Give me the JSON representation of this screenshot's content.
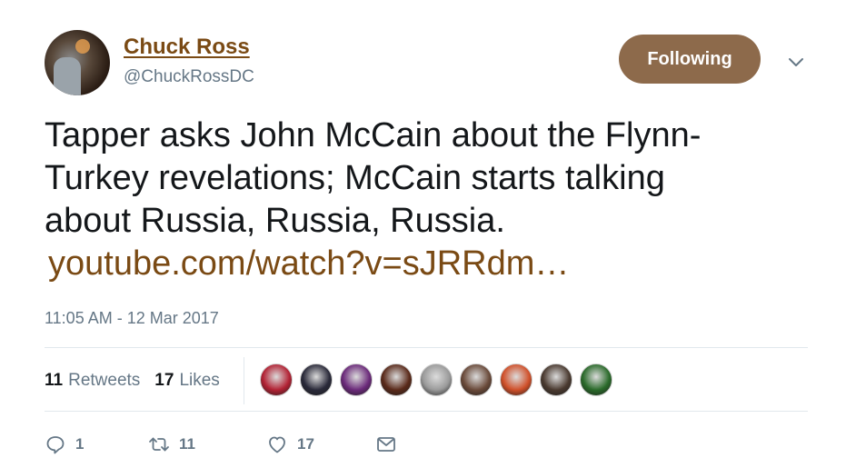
{
  "author": {
    "name": "Chuck Ross",
    "handle": "@ChuckRossDC"
  },
  "follow_button": {
    "label": "Following",
    "color": "#8d6a4b"
  },
  "tweet": {
    "line1": "Tapper asks John McCain about the Flynn-",
    "line2": "Turkey revelations; McCain starts talking",
    "line3": "about Russia, Russia, Russia.",
    "link": "youtube.com/watch?v=sJRRdm…",
    "link_color": "#7a4a14"
  },
  "timestamp": "11:05 AM - 12 Mar 2017",
  "stats": {
    "retweets_count": "11",
    "retweets_label": "Retweets",
    "likes_count": "17",
    "likes_label": "Likes"
  },
  "likers": [
    {
      "name": "liker-avatar-flag",
      "color": "#b22234"
    },
    {
      "name": "liker-avatar-2",
      "color": "#2a2a3a"
    },
    {
      "name": "liker-avatar-3",
      "color": "#6b2a7a"
    },
    {
      "name": "liker-avatar-4",
      "color": "#5a2a1a"
    },
    {
      "name": "liker-avatar-5",
      "color": "#9a9a9a"
    },
    {
      "name": "liker-avatar-6",
      "color": "#6a4a3a"
    },
    {
      "name": "liker-avatar-7",
      "color": "#d0502a"
    },
    {
      "name": "liker-avatar-8",
      "color": "#4a3a30"
    },
    {
      "name": "liker-avatar-9",
      "color": "#2a6a2a"
    }
  ],
  "actions": {
    "reply_count": "1",
    "retweet_count": "11",
    "like_count": "17"
  },
  "icons": {
    "reply": "reply-icon",
    "retweet": "retweet-icon",
    "like": "heart-icon",
    "dm": "envelope-icon",
    "more": "chevron-down-icon"
  }
}
